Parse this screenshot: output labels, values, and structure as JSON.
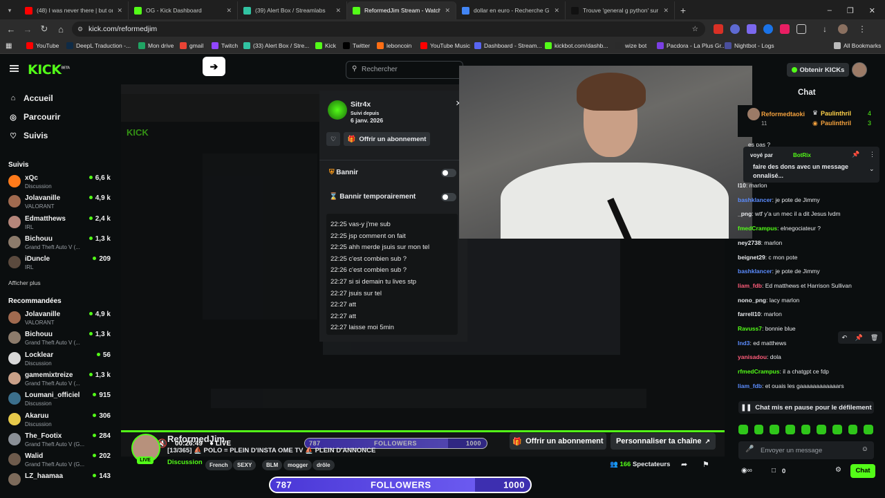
{
  "browser": {
    "tabs": [
      {
        "title": "(48) I was never there | but only",
        "color": "#ff0000"
      },
      {
        "title": "OG - Kick Dashboard",
        "color": "#53fc18"
      },
      {
        "title": "(39) Alert Box / Streamlabs",
        "color": "#31c3a2"
      },
      {
        "title": "ReformedJim Stream - Watch Li",
        "color": "#53fc18",
        "active": true
      },
      {
        "title": "dollar en euro - Recherche Goo",
        "color": "#4285f4"
      },
      {
        "title": "Trouve 'general g python' sur T",
        "color": "#111111"
      }
    ],
    "url": "kick.com/reformedjim",
    "bookmarks": [
      {
        "label": "YouTube",
        "color": "#ff0000"
      },
      {
        "label": "DeepL Traduction -...",
        "color": "#0f2b46"
      },
      {
        "label": "Mon drive",
        "color": "#1fa463"
      },
      {
        "label": "gmail",
        "color": "#ea4335"
      },
      {
        "label": "Twitch",
        "color": "#9146ff"
      },
      {
        "label": "(33) Alert Box / Stre...",
        "color": "#31c3a2"
      },
      {
        "label": "Kick",
        "color": "#53fc18"
      },
      {
        "label": "Twitter",
        "color": "#000000"
      },
      {
        "label": "leboncoin",
        "color": "#ff6e14"
      },
      {
        "label": "YouTube Music",
        "color": "#ff0000"
      },
      {
        "label": "Dashboard - Stream...",
        "color": "#5865f2"
      },
      {
        "label": "kickbot.com/dashb...",
        "color": "#53fc18"
      },
      {
        "label": "wize bot",
        "color": "#2b2b2b"
      },
      {
        "label": "Pacdora - La Plus Gr...",
        "color": "#7b3fe4"
      },
      {
        "label": "Nightbot - Logs",
        "color": "#4a4f9c"
      }
    ],
    "all_bookmarks": "All Bookmarks"
  },
  "kick": {
    "logo": "KICK",
    "logo_beta": "BETA",
    "search_placeholder": "Rechercher",
    "get_kicks": "Obtenir KICKs",
    "nav": [
      "Accueil",
      "Parcourir",
      "Suivis"
    ],
    "followed_header": "Suivis",
    "followed": [
      {
        "name": "xQc",
        "cat": "Discussion",
        "viewers": "6,6 k",
        "color": "#ff7a1a"
      },
      {
        "name": "Jolavanille",
        "cat": "VALORANT",
        "viewers": "4,9 k",
        "color": "#a06a4f"
      },
      {
        "name": "Edmatthews",
        "cat": "IRL",
        "viewers": "2,4 k",
        "color": "#b5867a"
      },
      {
        "name": "Bichouu",
        "cat": "Grand Theft Auto V (...",
        "viewers": "1,3 k",
        "color": "#8c7b6b"
      },
      {
        "name": "iDuncle",
        "cat": "IRL",
        "viewers": "209",
        "color": "#5b4a3e"
      }
    ],
    "show_more": "Afficher plus",
    "recommended_header": "Recommandées",
    "recommended": [
      {
        "name": "Jolavanille",
        "cat": "VALORANT",
        "viewers": "4,9 k",
        "color": "#a06a4f"
      },
      {
        "name": "Bichouu",
        "cat": "Grand Theft Auto V (...",
        "viewers": "1,3 k",
        "color": "#8c7b6b"
      },
      {
        "name": "Locklear",
        "cat": "Discussion",
        "viewers": "56",
        "color": "#d8d8d8"
      },
      {
        "name": "gamemixtreize",
        "cat": "Grand Theft Auto V (...",
        "viewers": "1,3 k",
        "color": "#c9a088"
      },
      {
        "name": "Loumani_officiel",
        "cat": "Discussion",
        "viewers": "915",
        "color": "#3b6f8c"
      },
      {
        "name": "Akaruu",
        "cat": "Discussion",
        "viewers": "306",
        "color": "#e6c94a"
      },
      {
        "name": "The_Footix",
        "cat": "Grand Theft Auto V (G...",
        "viewers": "284",
        "color": "#8a8f96"
      },
      {
        "name": "Walid",
        "cat": "Grand Theft Auto V (G...",
        "viewers": "202",
        "color": "#6e5b4c"
      },
      {
        "name": "LZ_haamaa",
        "cat": "",
        "viewers": "143",
        "color": "#7c6a5a"
      }
    ]
  },
  "mod_panel": {
    "user": "Sitr4x",
    "follow_since_label": "Suivi depuis",
    "follow_since": "6 janv. 2026",
    "gift_sub": "Offrir un abonnement",
    "ban": "Bannir",
    "timeout": "Bannir temporairement",
    "messages": [
      "22:25 vas-y j'me sub",
      "22:25 jsp comment on fait",
      "22:25 ahh merde jsuis sur mon tel",
      "22:25 c'est combien sub ?",
      "22:26 c'est combien sub ?",
      "22:27 si si demain tu lives stp",
      "22:27 jsuis sur tel",
      "22:27 att",
      "22:27 att",
      "22:27 laisse moi 5min"
    ]
  },
  "player": {
    "time": "00:26:49",
    "live": "LIVE",
    "followers_current": "787",
    "followers_label": "FOLLOWERS",
    "followers_goal": "1000",
    "followers_progress": 0.787
  },
  "stream": {
    "channel": "ReformedJim",
    "live_badge": "LIVE",
    "title": "[13/365] ⛵ POLO = PLEIN D'INSTA OME TV ⛵ PLEIN D'ANNONCE",
    "category": "Discussion",
    "tags": [
      "French",
      "SEXY",
      "BLM",
      "mogger",
      "drôle"
    ],
    "gift_sub": "Offrir un abonnement",
    "customize": "Personnaliser ta chaîne",
    "viewers": "166",
    "viewers_label": "Spectateurs"
  },
  "chat": {
    "title": "Chat",
    "leaders": [
      {
        "name": "Reformedtaoki",
        "sub": "11"
      },
      {
        "name": "Paulinthril",
        "count": "4"
      },
      {
        "name": "Paulinthril",
        "count": "3"
      }
    ],
    "pinned_by": "voyé par",
    "pinned_bot": "BotRix",
    "pinned_text": "faire des dons avec un message",
    "pinned_text2": "onnalisé...",
    "partial_top": "es pas ?",
    "messages": [
      {
        "user": "l10",
        "text": "marlon",
        "color": "#e8eaed"
      },
      {
        "user": "bashklancer",
        "text": "je pote de Jimmy",
        "color": "#5b8cff"
      },
      {
        "user": "_png",
        "text": "wtf y'a un mec il a dit Jesus lvdm",
        "color": "#e8eaed"
      },
      {
        "user": "fmedCrampus",
        "text": "elnegociateur ?",
        "color": "#53fc18"
      },
      {
        "user": "ney2738",
        "text": "marlon",
        "color": "#e8eaed"
      },
      {
        "user": "beignet29",
        "text": "c mon pote",
        "color": "#e8eaed"
      },
      {
        "user": "bashklancer",
        "text": "je pote de Jimmy",
        "color": "#5b8cff"
      },
      {
        "user": "liam_fdb",
        "text": "Ed matthews et Harrison Sullivan",
        "color": "#ff5c7a"
      },
      {
        "user": "nono_png",
        "text": "lacy marlon",
        "color": "#e8eaed"
      },
      {
        "user": "farrell10",
        "text": "marlon",
        "color": "#e8eaed"
      },
      {
        "user": "Ravuss7",
        "text": "bonnie blue",
        "color": "#53fc18"
      },
      {
        "user": "Ind3",
        "text": "ed matthews",
        "color": "#5b8cff"
      },
      {
        "user": "yanisadou",
        "text": "dola",
        "color": "#ff5c7a"
      },
      {
        "user": "rfmedCrampus",
        "text": "il a chatgpt ce fdp",
        "color": "#53fc18"
      },
      {
        "user": "liam_fdb",
        "text": "et ouais les gaaaaaaaaaaaars",
        "color": "#5b8cff"
      }
    ],
    "paused": "Chat mis en pause pour le défilement",
    "input_placeholder": "Envoyer un message",
    "kicks_count": "0",
    "send": "Chat"
  }
}
